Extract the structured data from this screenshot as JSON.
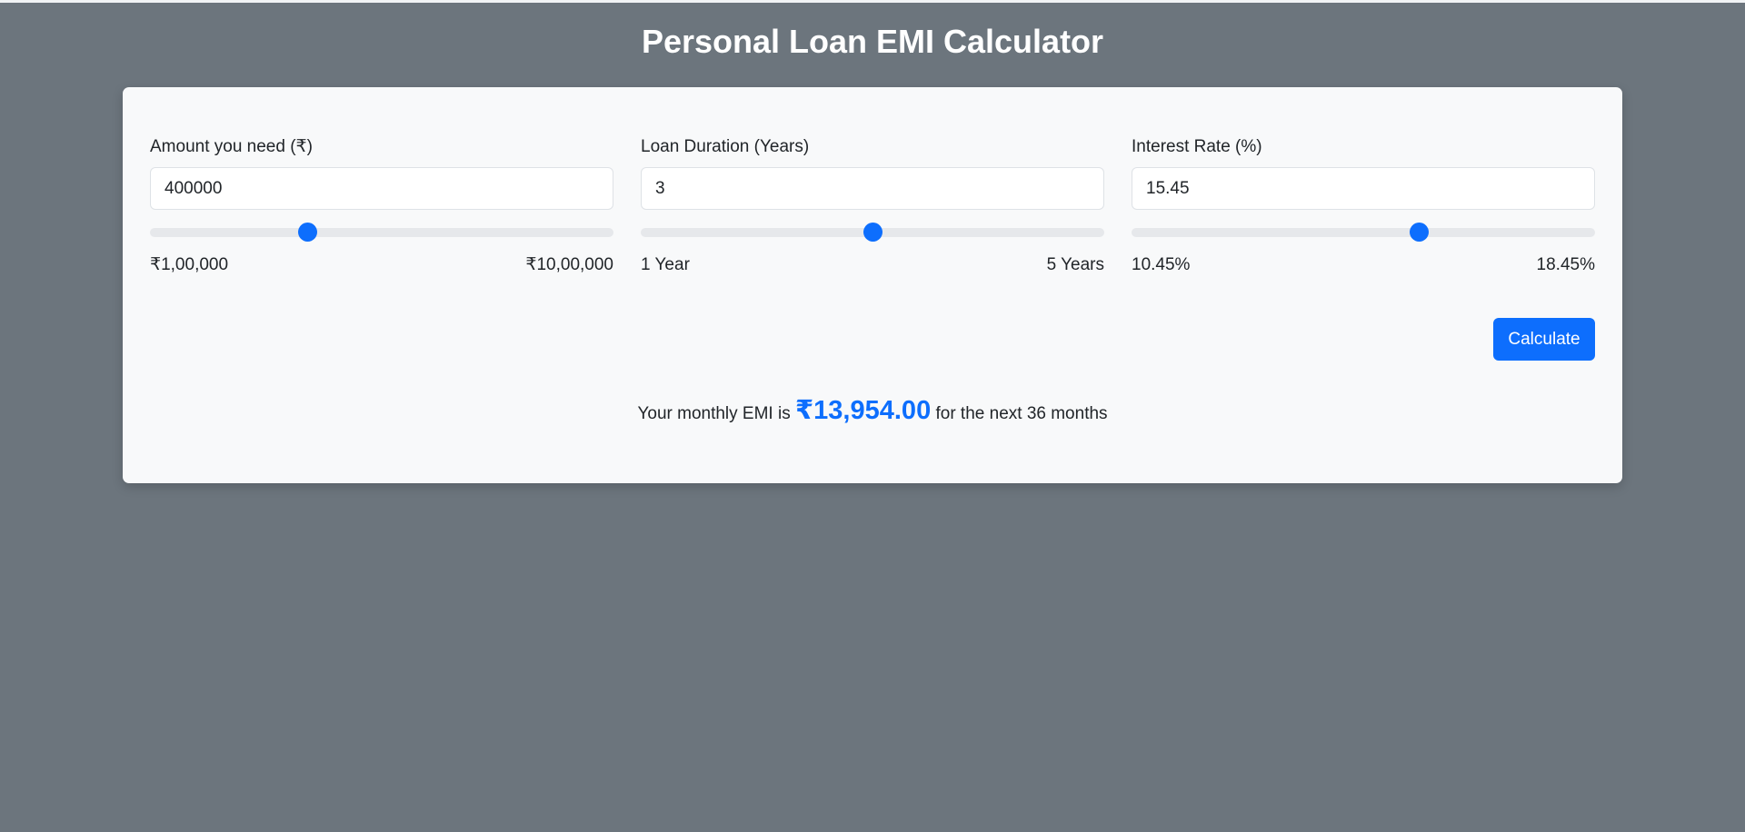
{
  "header": {
    "title": "Personal Loan EMI Calculator"
  },
  "fields": [
    {
      "label": "Amount you need (₹)",
      "value": "400000",
      "slider_fraction": 0.34,
      "min_label": "₹1,00,000",
      "max_label": "₹10,00,000"
    },
    {
      "label": "Loan Duration (Years)",
      "value": "3",
      "slider_fraction": 0.5,
      "min_label": "1 Year",
      "max_label": "5 Years"
    },
    {
      "label": "Interest Rate (%)",
      "value": "15.45",
      "slider_fraction": 0.62,
      "min_label": "10.45%",
      "max_label": "18.45%"
    }
  ],
  "actions": {
    "calculate_label": "Calculate"
  },
  "result": {
    "prefix": "Your monthly EMI is",
    "amount": "₹13,954.00",
    "suffix": "for the next 36 months"
  },
  "colors": {
    "accent": "#0d6efd",
    "background": "#6c757d",
    "card": "#f8f9fa"
  }
}
